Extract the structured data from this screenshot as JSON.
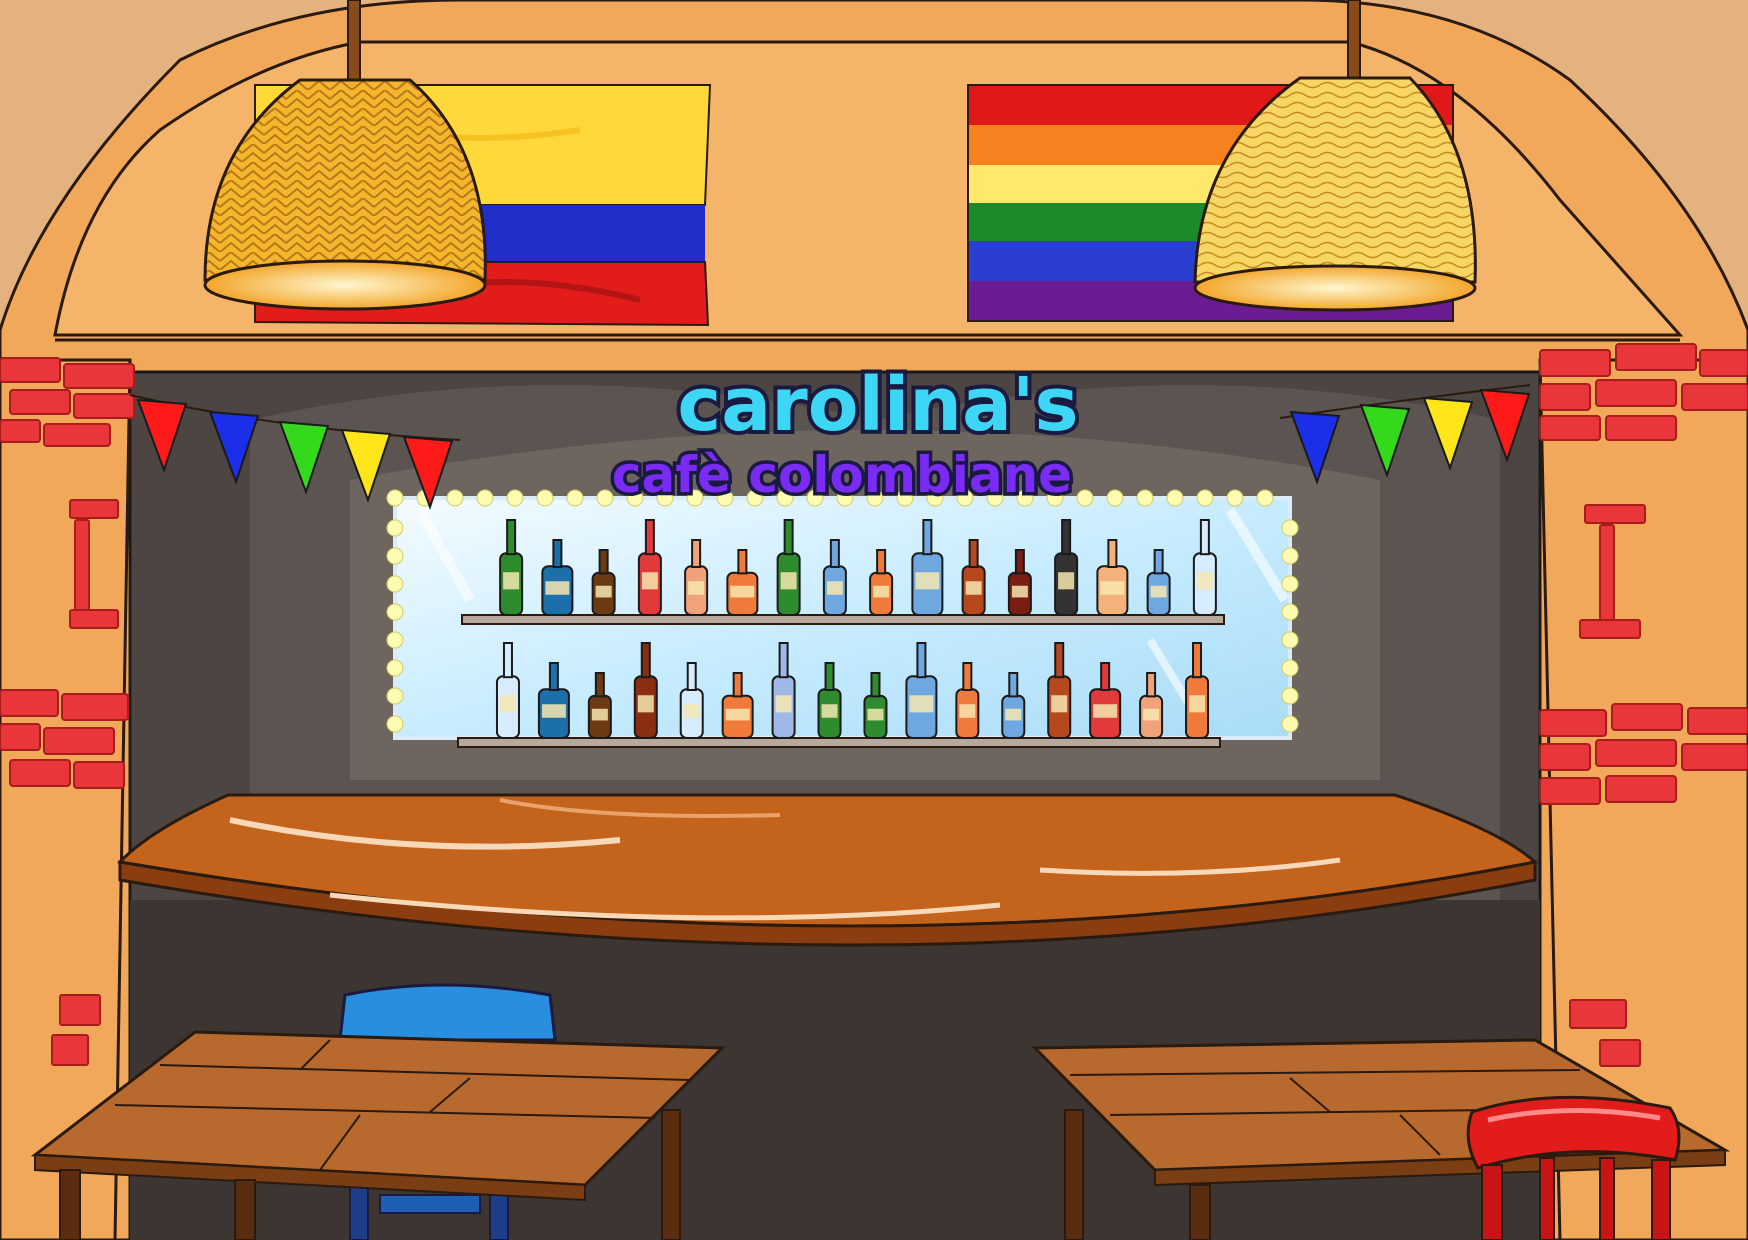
{
  "scene": {
    "name": "Carolina's Cafe Colombiane bar",
    "sign": {
      "title": "carolina's",
      "subtitle": "cafè colombiane"
    },
    "flags": [
      {
        "name": "colombia-flag",
        "stripes": [
          "#ffd93a",
          "#ffd93a",
          "#1f2fc8",
          "#e21b1b"
        ]
      },
      {
        "name": "rainbow-flag",
        "stripes": [
          "#e01818",
          "#f5821f",
          "#ffe86b",
          "#1d8a2a",
          "#2a3fd0",
          "#6a1d92"
        ]
      }
    ],
    "pennants": {
      "left": [
        "#ff1a1a",
        "#1b2ee8",
        "#33d91a",
        "#ffe61a",
        "#ff1a1a"
      ],
      "right": [
        "#1b2ee8",
        "#33d91a",
        "#ffe61a",
        "#ff1a1a"
      ]
    },
    "bottles": {
      "top_shelf": [
        "#2e8b2e",
        "#1c6fa8",
        "#6b3a12",
        "#e23a3a",
        "#f0a27a",
        "#f07a3a",
        "#2e8b2e",
        "#6fa8e0",
        "#f07a3a",
        "#6fa8e0",
        "#b5481d",
        "#7a1d12",
        "#333333",
        "#f4b27a",
        "#6fa8e0",
        "#d8ecff"
      ],
      "bottom_shelf": [
        "#d8ecff",
        "#1c6fa8",
        "#6b3a12",
        "#8a2e12",
        "#d8ecff",
        "#f07a3a",
        "#9fb8e8",
        "#2e8b2e",
        "#2e8b2e",
        "#6fa8e0",
        "#f07a3a",
        "#6fa8e0",
        "#b5481d",
        "#e23a3a",
        "#f0a27a",
        "#f07a3a"
      ]
    },
    "chairs": [
      {
        "name": "blue-chair",
        "color": "#2a8ee0"
      },
      {
        "name": "red-chair",
        "color": "#e21b1b"
      }
    ],
    "colors": {
      "wall": "#f2a85a",
      "beam": "#f4b56a",
      "brick": "#e8363a",
      "interior": "#4d4541",
      "counter": "#c4641c",
      "table": "#b86a2e",
      "sign_outline": "#1a1a40"
    }
  }
}
